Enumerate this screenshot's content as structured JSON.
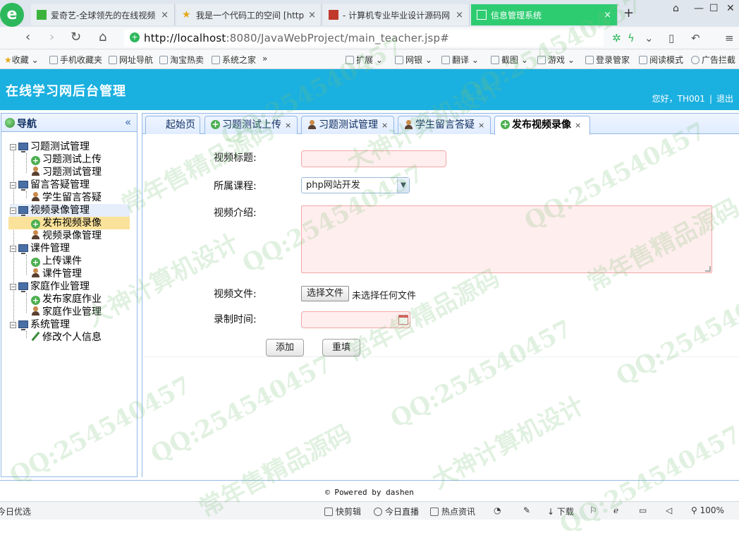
{
  "browser": {
    "logo_letter": "e",
    "tabs": [
      {
        "title": "爱奇艺-全球领先的在线视频",
        "close": "×"
      },
      {
        "title": "我是一个代码工的空间 [http",
        "close": "×"
      },
      {
        "title": "- 计算机专业毕业设计源码网",
        "close": "×"
      },
      {
        "title": "信息管理系统",
        "close": "×"
      }
    ],
    "new_tab": "+",
    "url_host": "http://localhost",
    "url_path": ":8080/JavaWebProject/main_teacher.jsp#",
    "bookmarks": [
      "收藏",
      "手机收藏夹",
      "网址导航",
      "淘宝热卖",
      "系统之家",
      "»",
      "扩展",
      "网银",
      "翻译",
      "截图",
      "游戏",
      "登录管家",
      "阅读模式",
      "广告拦截"
    ]
  },
  "app": {
    "title": "在线学习网后台管理",
    "greeting": "您好，TH001",
    "separator": "|",
    "logout": "退出"
  },
  "nav": {
    "title": "导航",
    "collapse": "«",
    "groups": [
      {
        "label": "习题测试管理",
        "items": [
          "习题测试上传",
          "习题测试管理"
        ]
      },
      {
        "label": "留言答疑管理",
        "items": [
          "学生留言答疑"
        ]
      },
      {
        "label": "视频录像管理",
        "items": [
          "发布视频录像",
          "视频录像管理"
        ]
      },
      {
        "label": "课件管理",
        "items": [
          "上传课件",
          "课件管理"
        ]
      },
      {
        "label": "家庭作业管理",
        "items": [
          "发布家庭作业",
          "家庭作业管理"
        ]
      },
      {
        "label": "系统管理",
        "items": [
          "修改个人信息"
        ]
      }
    ]
  },
  "tabs": [
    {
      "label": "起始页"
    },
    {
      "label": "习题测试上传",
      "close": "×"
    },
    {
      "label": "习题测试管理",
      "close": "×"
    },
    {
      "label": "学生留言答疑",
      "close": "×"
    },
    {
      "label": "发布视频录像",
      "close": "×"
    }
  ],
  "form": {
    "title_label": "视频标题:",
    "title_value": "",
    "course_label": "所属课程:",
    "course_selected": "php网站开发",
    "intro_label": "视频介绍:",
    "intro_value": "",
    "file_label": "视频文件:",
    "file_button": "选择文件",
    "file_status": "未选择任何文件",
    "time_label": "录制时间:",
    "time_value": "",
    "submit": "添加",
    "reset": "重填"
  },
  "footer": {
    "powered": "© Powered by dashen"
  },
  "statusbar": [
    "今日优选",
    "快剪辑",
    "今日直播",
    "热点资讯",
    "下载",
    "100%"
  ],
  "watermark": {
    "qq": "QQ:254540457",
    "design": "大神计算机设计",
    "source": "常年售精品源码"
  },
  "colors": {
    "header": "#1ab0e0",
    "active_tab": "#2ecc71",
    "selected": "#fbe29a",
    "border": "#95b8e7"
  }
}
